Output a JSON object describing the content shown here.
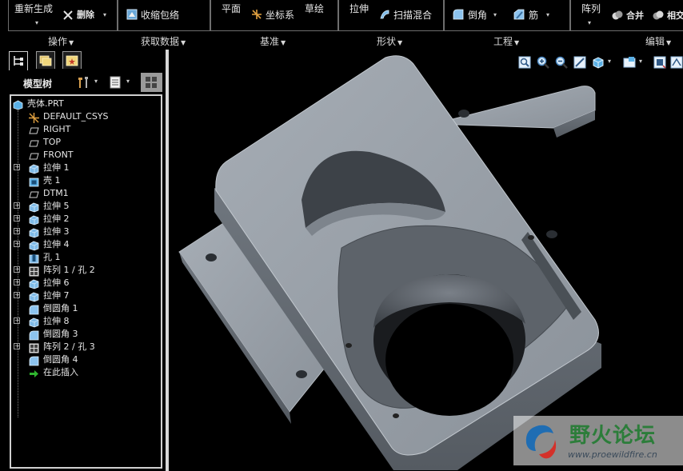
{
  "ribbon": {
    "regenerate": "重新生成",
    "delete": "删除",
    "shrinkwrap": "收缩包络",
    "plane": "平面",
    "csys": "坐标系",
    "sketch": "草绘",
    "extrude": "拉伸",
    "sweep_blend": "扫描混合",
    "round": "倒角",
    "rib": "筋",
    "pattern": "阵列",
    "merge": "合并",
    "intersect": "相交",
    "groups": [
      "操作",
      "获取数据",
      "基准",
      "形状",
      "工程",
      "编辑"
    ]
  },
  "panel": {
    "tabs": [
      "model-tree-tab",
      "layer-tab",
      "favorites-tab"
    ],
    "header": "模型树"
  },
  "tree": {
    "items": [
      {
        "label": "壳体.PRT",
        "icon": "part-icon",
        "expand": false
      },
      {
        "label": "DEFAULT_CSYS",
        "icon": "csys-icon",
        "expand": false
      },
      {
        "label": "RIGHT",
        "icon": "datum-plane-icon",
        "expand": false
      },
      {
        "label": "TOP",
        "icon": "datum-plane-icon",
        "expand": false
      },
      {
        "label": "FRONT",
        "icon": "datum-plane-icon",
        "expand": false
      },
      {
        "label": "拉伸 1",
        "icon": "extrude-icon",
        "expand": true
      },
      {
        "label": "壳 1",
        "icon": "shell-icon",
        "expand": false
      },
      {
        "label": "DTM1",
        "icon": "datum-plane-icon",
        "expand": false
      },
      {
        "label": "拉伸 5",
        "icon": "extrude-icon",
        "expand": true
      },
      {
        "label": "拉伸 2",
        "icon": "extrude-icon",
        "expand": true
      },
      {
        "label": "拉伸 3",
        "icon": "extrude-icon",
        "expand": true
      },
      {
        "label": "拉伸 4",
        "icon": "extrude-icon",
        "expand": true
      },
      {
        "label": "孔 1",
        "icon": "hole-icon",
        "expand": false
      },
      {
        "label": "阵列 1 / 孔 2",
        "icon": "pattern-icon",
        "expand": true
      },
      {
        "label": "拉伸 6",
        "icon": "extrude-icon",
        "expand": true
      },
      {
        "label": "拉伸 7",
        "icon": "extrude-icon",
        "expand": true
      },
      {
        "label": "倒圆角 1",
        "icon": "round-icon",
        "expand": false
      },
      {
        "label": "拉伸 8",
        "icon": "extrude-icon",
        "expand": true
      },
      {
        "label": "倒圆角 3",
        "icon": "round-icon",
        "expand": false
      },
      {
        "label": "阵列 2 / 孔 3",
        "icon": "pattern-icon",
        "expand": true
      },
      {
        "label": "倒圆角 4",
        "icon": "round-icon",
        "expand": false
      },
      {
        "label": "在此插入",
        "icon": "insert-arrow-icon",
        "expand": false
      }
    ]
  },
  "watermark": {
    "title": "野火论坛",
    "url": "www.proewildfire.cn"
  },
  "colors": {
    "part": "#8e959e",
    "accent_icon": "#5ab0e6",
    "insert_arrow": "#2fb52f"
  }
}
